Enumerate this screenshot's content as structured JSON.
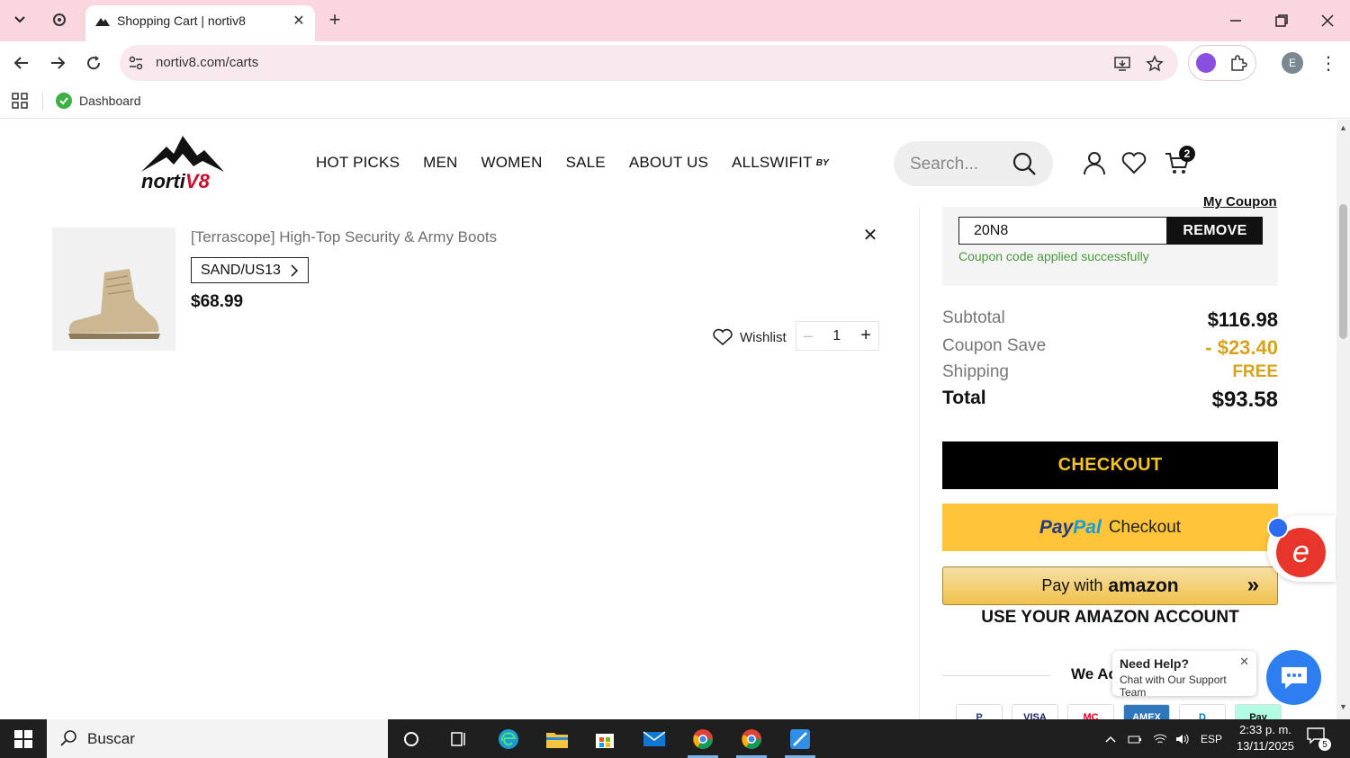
{
  "browser": {
    "tab_title": "Shopping Cart | nortiv8",
    "url": "nortiv8.com/carts",
    "bookmark_label": "Dashboard",
    "profile_initial": "E"
  },
  "site": {
    "logo_text_a": "norti",
    "logo_text_b": "V8",
    "nav": [
      "HOT PICKS",
      "MEN",
      "WOMEN",
      "SALE",
      "ABOUT US",
      "ALLSWIFIT"
    ],
    "nav_by": "BY",
    "search_placeholder": "Search...",
    "cart_count": "2"
  },
  "cart_item": {
    "name": "[Terrascope] High-Top Security & Army Boots",
    "variant": "SAND/US13",
    "price": "$68.99",
    "wishlist_label": "Wishlist",
    "quantity": "1",
    "minus": "–",
    "plus": "+"
  },
  "summary": {
    "my_coupon_label": "My Coupon",
    "coupon_code": "20N8",
    "remove_label": "REMOVE",
    "coupon_message": "Coupon code applied successfully",
    "subtotal_label": "Subtotal",
    "subtotal_value": "$116.98",
    "coupon_save_label": "Coupon Save",
    "coupon_save_value": "- $23.40",
    "shipping_label": "Shipping",
    "shipping_value": "FREE",
    "total_label": "Total",
    "total_value": "$93.58",
    "checkout_label": "CHECKOUT",
    "paypal_pay": "Pay",
    "paypal_pal": "Pal",
    "paypal_checkout": "Checkout",
    "amazon_pay_with": "Pay with",
    "amazon_brand": "amazon",
    "amazon_account": "USE YOUR AMAZON ACCOUNT",
    "accept_text": "We Ac",
    "payment_methods": [
      "P",
      "VISA",
      "MC",
      "AMEX",
      "D",
      "Pay"
    ]
  },
  "help": {
    "title": "Need Help?",
    "subtitle": "Chat with Our Support Team"
  },
  "taskbar": {
    "search_placeholder": "Buscar",
    "language": "ESP",
    "time": "2:33 p. m.",
    "date": "13/11/2025",
    "notifications": "5"
  },
  "colors": {
    "tabbar": "#f9d6e0",
    "accent_gold": "#d9a21b",
    "checkout_text": "#f3c12a",
    "paypal_bg": "#ffc439",
    "coupon_success": "#4a9a3b"
  }
}
